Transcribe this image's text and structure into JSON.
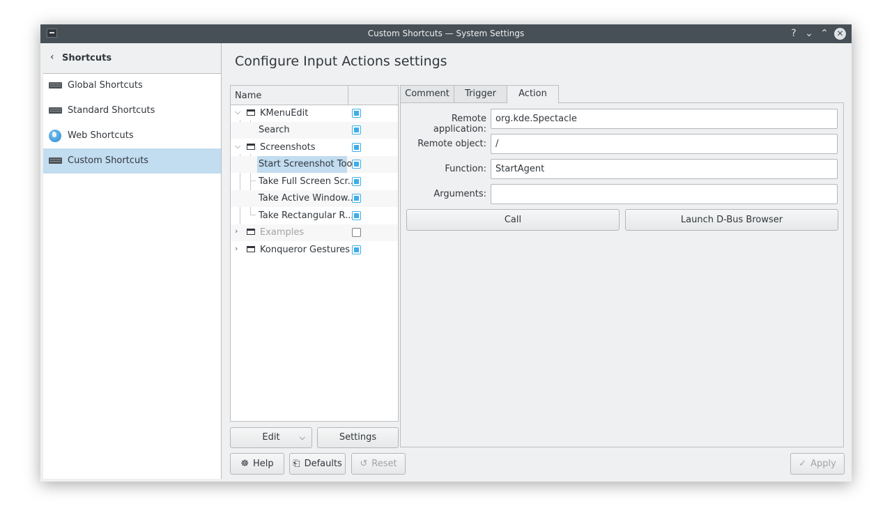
{
  "window": {
    "title": "Custom Shortcuts — System Settings"
  },
  "titlebar_controls": {
    "help": "?",
    "minimize": "⌄",
    "maximize": "⌃",
    "close": "✕"
  },
  "sidebar": {
    "back_label": "Shortcuts",
    "items": [
      {
        "label": "Global Shortcuts",
        "icon": "keyboard-icon"
      },
      {
        "label": "Standard Shortcuts",
        "icon": "keyboard-icon"
      },
      {
        "label": "Web Shortcuts",
        "icon": "globe-icon"
      },
      {
        "label": "Custom Shortcuts",
        "icon": "keyboard-icon",
        "selected": true
      }
    ]
  },
  "main": {
    "title": "Configure Input Actions settings",
    "tree": {
      "column_name": "Name",
      "rows": [
        {
          "label": "KMenuEdit",
          "type": "group",
          "expanded": true,
          "enabled": true
        },
        {
          "label": "Search",
          "type": "action",
          "enabled": true
        },
        {
          "label": "Screenshots",
          "type": "group",
          "expanded": true,
          "enabled": true
        },
        {
          "label": "Start Screenshot Tool",
          "type": "action",
          "enabled": true,
          "selected": true
        },
        {
          "label": "Take Full Screen Scr...",
          "type": "action",
          "enabled": true
        },
        {
          "label": "Take Active Window...",
          "type": "action",
          "enabled": true
        },
        {
          "label": "Take Rectangular R...",
          "type": "action",
          "enabled": true
        },
        {
          "label": "Examples",
          "type": "group",
          "expanded": false,
          "enabled": false
        },
        {
          "label": "Konqueror Gestures",
          "type": "group",
          "expanded": false,
          "enabled": true
        }
      ]
    },
    "tree_buttons": {
      "edit": "Edit",
      "settings": "Settings"
    },
    "tabs": [
      {
        "label": "Comment"
      },
      {
        "label": "Trigger"
      },
      {
        "label": "Action",
        "active": true
      }
    ],
    "action_form": {
      "remote_application_label": "Remote application:",
      "remote_application_value": "org.kde.Spectacle",
      "remote_object_label": "Remote object:",
      "remote_object_value": "/",
      "function_label": "Function:",
      "function_value": "StartAgent",
      "arguments_label": "Arguments:",
      "arguments_value": "",
      "call_button": "Call",
      "dbus_button": "Launch D-Bus Browser"
    }
  },
  "footer": {
    "help": "Help",
    "defaults": "Defaults",
    "reset": "Reset",
    "apply": "Apply"
  },
  "colors": {
    "accent": "#3daee9",
    "selection": "#c2dcf0",
    "titlebar": "#475057",
    "window": "#eff0f1"
  }
}
